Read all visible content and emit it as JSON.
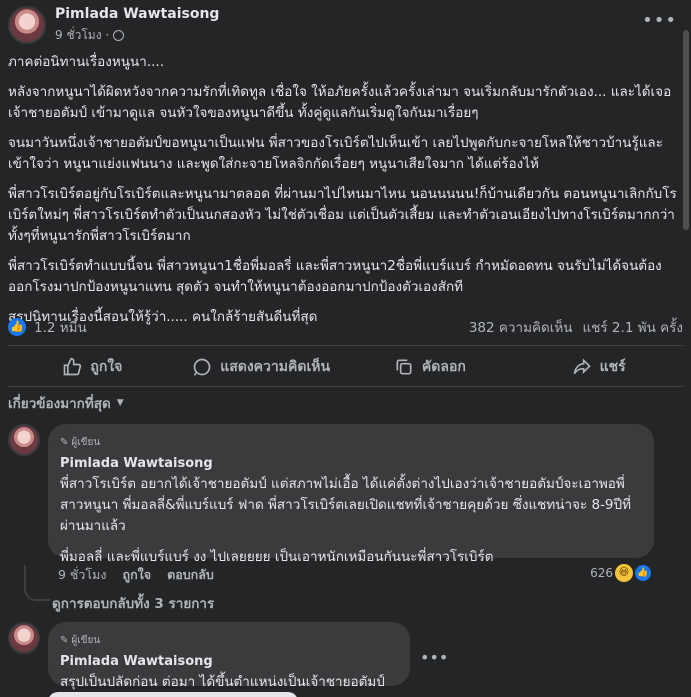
{
  "post": {
    "author": "Pimlada Wawtaisong",
    "time": "9 ชั่วโมง ·",
    "paragraphs": [
      "ภาคต่อนิทานเรื่องหนูนา....",
      "หลังจากหนูนาได้ผิดหวังจากความรักที่เทิดทูล เชื่อใจ ให้อภัยครั้งแล้วครั้งเล่ามา จนเริ่มกลับมารักตัวเอง... และได้เจอเจ้าชายอตัมป์ เข้ามาดูแล จนหัวใจของหนูนาดีขึ้น ทั้งคู่ดูแลกันเริ่มดูใจกันมาเรื่อยๆ",
      "จนมาวันหนึ่งเจ้าชายอตัมป์ขอหนูนาเป็นแฟน พี่สาวของโรเบิร์ตไปเห็นเข้า เลยไปพูดกับกะจายโหลให้ชาวบ้านรู้และเข้าใจว่า หนูนาแย่งแฟนนาง และพูดใส่กะจายโหลจิกกัดเรื่อยๆ  หนูนาเสียใจมาก ได้แต่ร้องไห้",
      "พี่สาวโรเบิร์ตอยู่กับโรเบิร์ตและหนูนามาตลอด ที่ผ่านมาไปไหนมาไหน นอนนนนน!ก็บ้านเดียวกัน ตอนหนูนาเลิกกับโรเบิร์ตใหม่ๆ พี่สาวโรเบิร์ตทำตัวเป็นนกสองหัว ไม่ใช่ตัวเชื่อม แต่เป็นตัวเสี้ยม และทำตัวเอนเอียงไปทางโรเบิร์ตมากกว่า ทั้งๆที่หนูนารักพี่สาวโรเบิร์ตมาก",
      "พี่สาวโรเบิร์ตทำแบบนี้จน พี่สาวหนูนา1ชื่อพี่มอลรี่ และพี่สาวหนูนา2ชื่อพี่แบร์แบร์ กำหมัดอดทน จนรับไม่ได้จนต้องออกโรงมาปกป้องหนูนาแทน สุดตัว จนทำให้หนูนาต้องออกมาปกป้องตัวเองสักที",
      "สรุปนิทานเรื่องนี้สอนให้รู้ว่า..... คนใกล้ร้ายสันดีนที่สุด"
    ],
    "likes": "1.2 หมื่น",
    "comments_count": "382 ความคิดเห็น",
    "shares_count": "แชร์ 2.1 พัน ครั้ง"
  },
  "actions": {
    "like": "ถูกใจ",
    "comment": "แสดงความคิดเห็น",
    "copy": "คัดลอก",
    "share": "แชร์"
  },
  "filter": {
    "label": "เกี่ยวข้องมากที่สุด"
  },
  "comments": [
    {
      "badge": "ผู้เขียน",
      "author": "Pimlada Wawtaisong",
      "paragraphs": [
        "พี่สาวโรเบิร์ต อยากได้เจ้าชายอตัมป์ แต่สภาพไม่เอื้อ ได้แค่ตั้งต่างไปเองว่าเจ้าชายอตัมป์จะเอาพอพี่สาวหนูนา พี่มอลลี่&พี่แบร์แบร์ ฟาด พี่สาวโรเบิร์ตเลยเปิดแชทที่เจ้าชายคุยด้วย ซึ่งแชทน่าจะ 8-9ปีที่ผ่านมาแล้ว",
        "พี่มอลลี่ และพี่แบร์แบร์ งง ไปเลยยยย เป็นเอาหนักเหมือนกันนะพี่สาวโรเบิร์ต"
      ],
      "time": "9 ชั่วโมง",
      "like": "ถูกใจ",
      "reply": "ตอบกลับ",
      "reactions": "626"
    },
    {
      "badge": "ผู้เขียน",
      "author": "Pimlada Wawtaisong",
      "paragraphs": [
        "สรุปเป็นปลัดก่อน ต่อมา ได้ขึ้นตำแหน่งเป็นเจ้าชายอตัมป์"
      ]
    }
  ],
  "view_replies": "ดูการตอบกลับทั้ง 3 รายการ",
  "colors": {
    "background": "#242526",
    "bubble": "#3a3b3c",
    "accent": "#1877f2"
  }
}
